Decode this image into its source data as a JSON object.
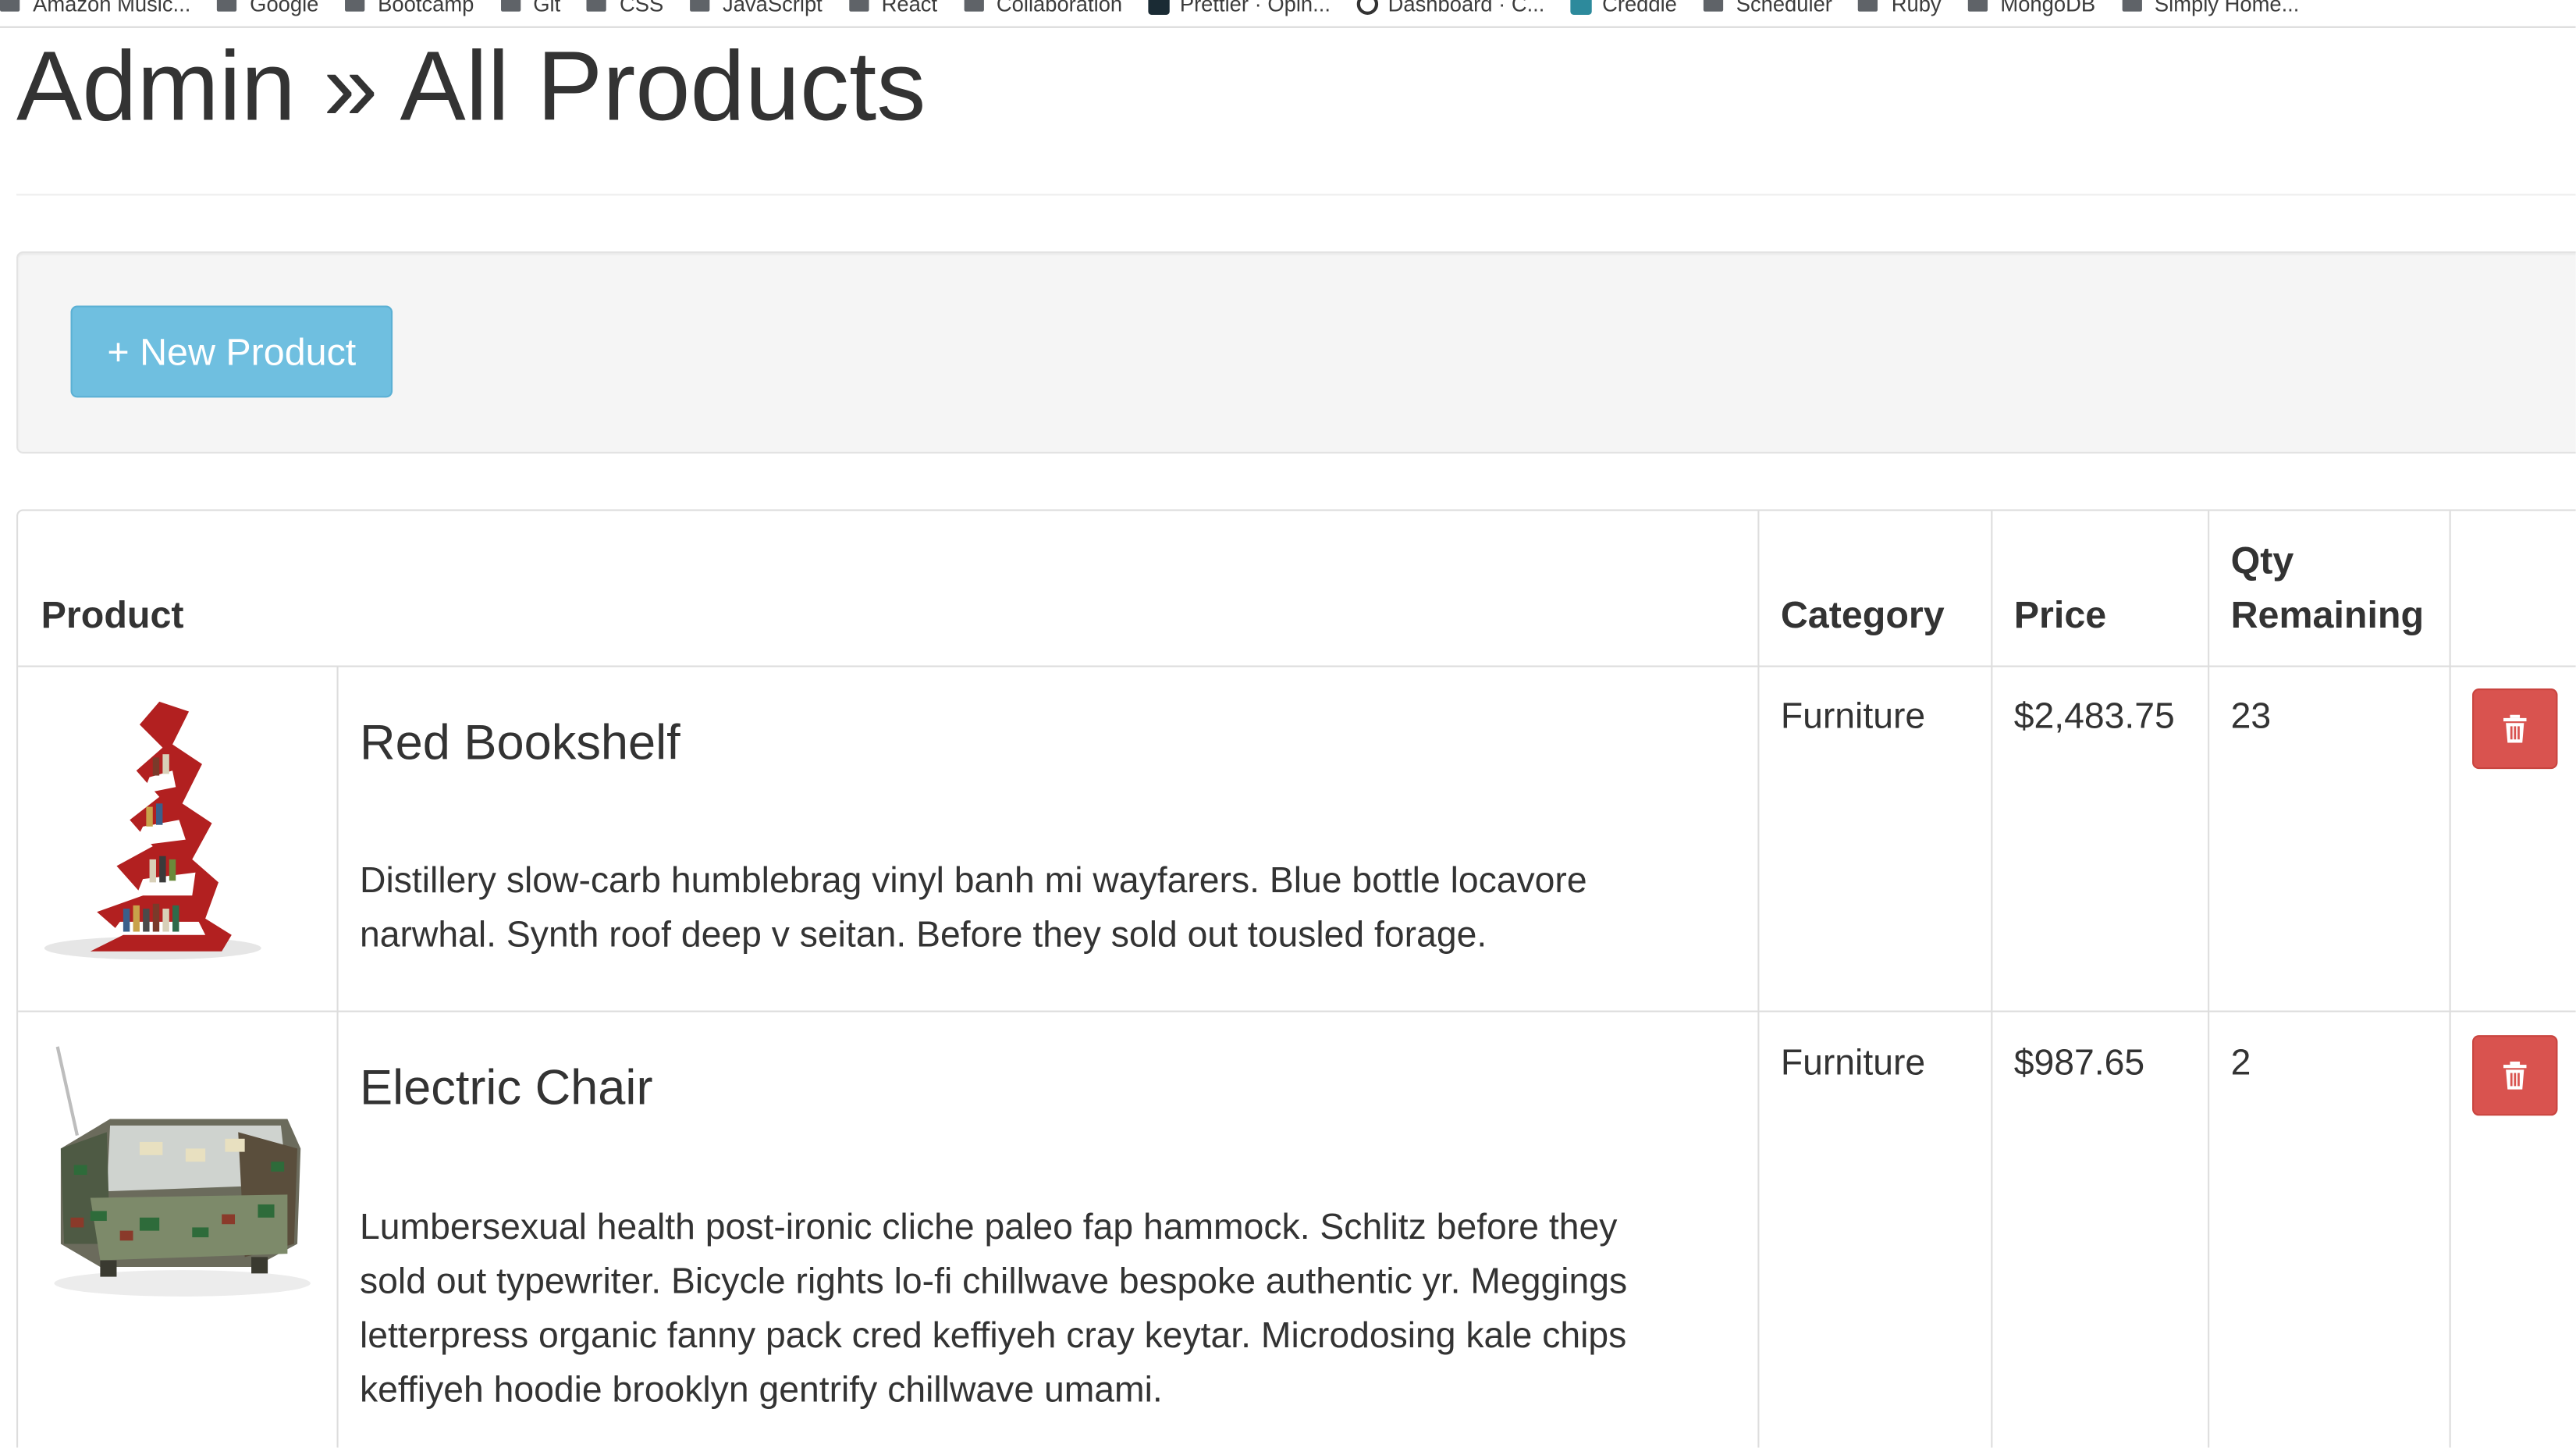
{
  "bookmarks": [
    {
      "label": "Amazon Music...",
      "icon": "folder-icon"
    },
    {
      "label": "Google",
      "icon": "folder-icon"
    },
    {
      "label": "Bootcamp",
      "icon": "folder-icon"
    },
    {
      "label": "Git",
      "icon": "folder-icon"
    },
    {
      "label": "CSS",
      "icon": "folder-icon"
    },
    {
      "label": "JavaScript",
      "icon": "folder-icon"
    },
    {
      "label": "React",
      "icon": "folder-icon"
    },
    {
      "label": "Collaboration",
      "icon": "folder-icon"
    },
    {
      "label": "Prettier · Opin...",
      "icon": "prettier-favicon"
    },
    {
      "label": "Dashboard · C...",
      "icon": "dashboard-favicon"
    },
    {
      "label": "Creddle",
      "icon": "creddle-favicon"
    },
    {
      "label": "Scheduler",
      "icon": "folder-icon"
    },
    {
      "label": "Ruby",
      "icon": "folder-icon"
    },
    {
      "label": "MongoDB",
      "icon": "folder-icon"
    },
    {
      "label": "Simply Home...",
      "icon": "folder-icon"
    }
  ],
  "header": {
    "title": "Admin » All Products"
  },
  "toolbar": {
    "new_product_label": "+ New Product"
  },
  "table": {
    "columns": {
      "product": "Product",
      "category": "Category",
      "price": "Price",
      "qty_line1": "Qty",
      "qty_line2": "Remaining"
    },
    "rows": [
      {
        "name": "Red Bookshelf",
        "description_line1": "Distillery slow-carb humblebrag vinyl banh mi wayfarers. Blue bottle locavore",
        "description_line2": "narwhal. Synth roof deep v seitan. Before they sold out tousled forage.",
        "category": "Furniture",
        "price": "$2,483.75",
        "qty": "23",
        "image": "red-bookshelf-image",
        "delete_icon": "trash-icon"
      },
      {
        "name": "Electric Chair",
        "description_line1": "Lumbersexual health post-ironic cliche paleo fap hammock. Schlitz before they",
        "description_line2": "sold out typewriter. Bicycle rights lo-fi chillwave bespoke authentic yr. Meggings",
        "description_line3": "letterpress organic fanny pack cred keffiyeh cray keytar. Microdosing kale chips",
        "description_line4": "keffiyeh hoodie brooklyn gentrify chillwave umami.",
        "category": "Furniture",
        "price": "$987.65",
        "qty": "2",
        "image": "electric-chair-image",
        "delete_icon": "trash-icon"
      }
    ]
  },
  "colors": {
    "info_button": "#6fbfe0",
    "danger_button": "#d9534f",
    "well_background": "#f5f5f5",
    "text": "#333333"
  }
}
